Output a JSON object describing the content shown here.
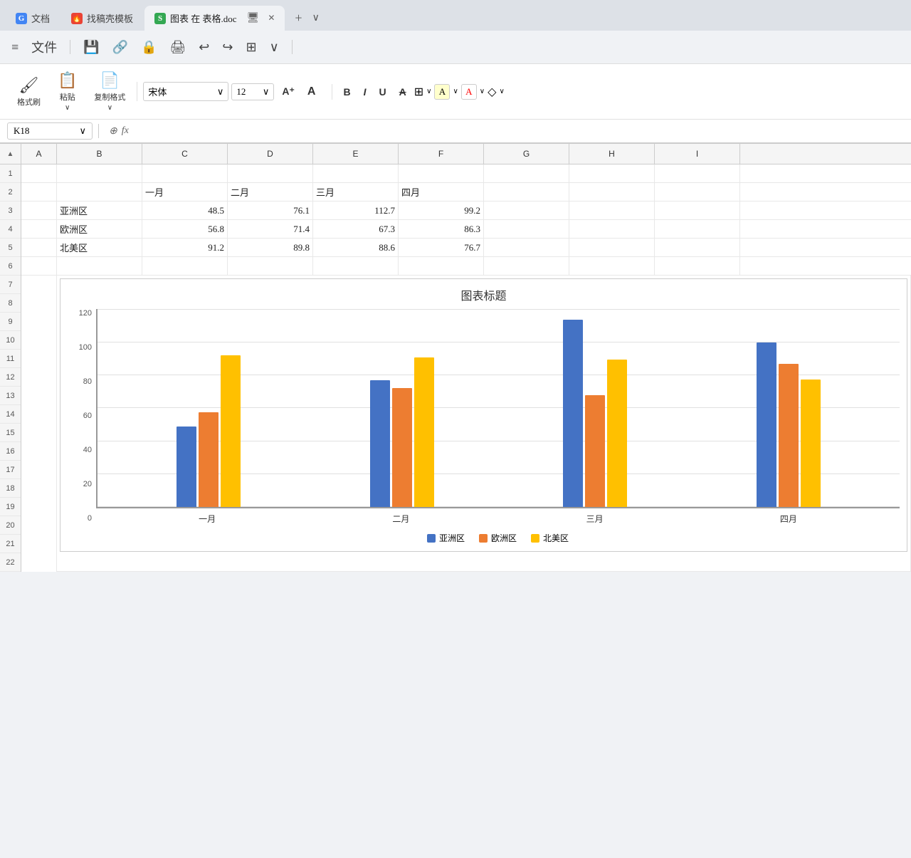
{
  "tabs": [
    {
      "id": "docs",
      "label": "文档",
      "icon": "G",
      "iconClass": "blue",
      "active": false
    },
    {
      "id": "template",
      "label": "找稿壳模板",
      "icon": "🔥",
      "iconClass": "red",
      "active": false
    },
    {
      "id": "chart",
      "label": "图表 在 表格.doc",
      "icon": "S",
      "iconClass": "green",
      "active": true
    }
  ],
  "toolbar": {
    "menu_items": [
      "文件"
    ],
    "format_brush": "格式刷",
    "paste": "粘贴",
    "copy_format": "复制格式",
    "font_name": "宋体",
    "font_size": "12",
    "bold": "B",
    "italic": "I",
    "underline": "U"
  },
  "formula_bar": {
    "cell_ref": "K18",
    "fx": "fx"
  },
  "columns": [
    "A",
    "B",
    "C",
    "D",
    "E",
    "F",
    "G",
    "H",
    "I"
  ],
  "rows": [
    1,
    2,
    3,
    4,
    5,
    6,
    7,
    8,
    9,
    10,
    11,
    12,
    13,
    14,
    15,
    16,
    17,
    18,
    19,
    20,
    21,
    22
  ],
  "data": {
    "row2": {
      "B": "",
      "C": "一月",
      "D": "二月",
      "E": "三月",
      "F": "四月"
    },
    "row3": {
      "B": "亚洲区",
      "C": "48.5",
      "D": "76.1",
      "E": "112.7",
      "F": "99.2"
    },
    "row4": {
      "B": "欧洲区",
      "C": "56.8",
      "D": "71.4",
      "E": "67.3",
      "F": "86.3"
    },
    "row5": {
      "B": "北美区",
      "C": "91.2",
      "D": "89.8",
      "E": "88.6",
      "F": "76.7"
    }
  },
  "chart": {
    "title": "图表标题",
    "y_axis": [
      "120",
      "100",
      "80",
      "60",
      "40",
      "20",
      "0"
    ],
    "x_labels": [
      "一月",
      "二月",
      "三月",
      "四月"
    ],
    "series": [
      {
        "name": "亚洲区",
        "color": "blue",
        "values": [
          48.5,
          76.1,
          112.7,
          99.2
        ]
      },
      {
        "name": "欧洲区",
        "color": "orange",
        "values": [
          56.8,
          71.4,
          67.3,
          86.3
        ]
      },
      {
        "name": "北美区",
        "color": "yellow",
        "values": [
          91.2,
          89.8,
          88.6,
          76.7
        ]
      }
    ],
    "y_max": 120,
    "legend": [
      "亚洲区",
      "欧洲区",
      "北美区"
    ]
  }
}
